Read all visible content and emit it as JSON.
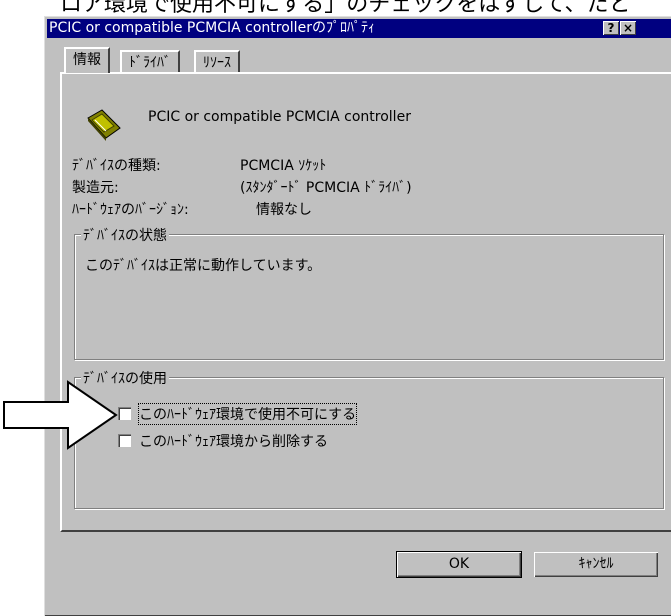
{
  "caption_top": "ロア環境で使用不可にする」のチェックをはずして、たと",
  "window": {
    "title": "PCIC or compatible PCMCIA controllerのﾌﾟﾛﾊﾟﾃｨ",
    "help_button": "?",
    "close_button": "×"
  },
  "tabs": [
    {
      "label": "情報",
      "active": true
    },
    {
      "label": "ﾄﾞﾗｲﾊﾞ",
      "active": false
    },
    {
      "label": "ﾘｿｰｽ",
      "active": false
    }
  ],
  "device": {
    "name": "PCIC or compatible PCMCIA controller",
    "icon": "pcmcia-card-icon",
    "type_label": "ﾃﾞﾊﾞｲｽの種類:",
    "type_value": "PCMCIA ｿｹｯﾄ",
    "maker_label": "製造元:",
    "maker_value": "(ｽﾀﾝﾀﾞｰﾄﾞ PCMCIA ﾄﾞﾗｲﾊﾞ)",
    "hw_version_label": "ﾊｰﾄﾞｳｪｱのﾊﾞｰｼﾞｮﾝ:",
    "hw_version_value": "情報なし"
  },
  "status_group": {
    "legend": "ﾃﾞﾊﾞｲｽの状態",
    "text": "このﾃﾞﾊﾞｲｽは正常に動作しています。"
  },
  "usage_group": {
    "legend": "ﾃﾞﾊﾞｲｽの使用",
    "disable_label": "このﾊｰﾄﾞｳｪｱ環境で使用不可にする",
    "disable_checked": false,
    "remove_label": "このﾊｰﾄﾞｳｪｱ環境から削除する",
    "remove_checked": false
  },
  "buttons": {
    "ok": "OK",
    "cancel": "ｷｬﾝｾﾙ"
  },
  "annotation": {
    "arrow_icon": "right-arrow-icon"
  }
}
